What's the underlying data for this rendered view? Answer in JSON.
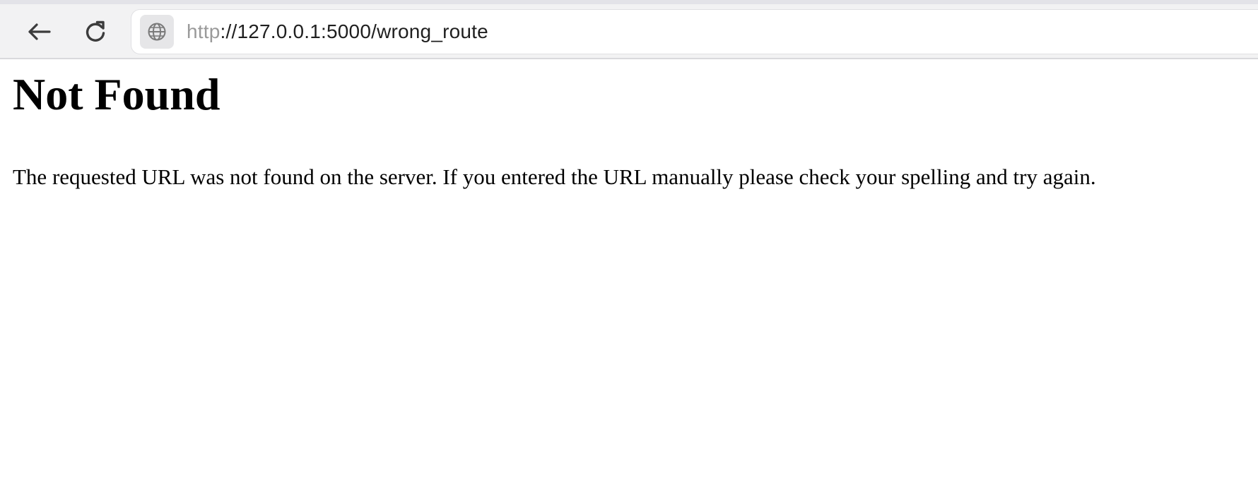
{
  "browser": {
    "address_bar": {
      "scheme": "http",
      "rest": "://127.0.0.1:5000/wrong_route"
    },
    "icons": {
      "back": "arrow-left-icon",
      "reload": "reload-icon",
      "site_info": "globe-icon"
    }
  },
  "page": {
    "title": "Not Found",
    "message": "The requested URL was not found on the server. If you entered the URL manually please check your spelling and try again."
  }
}
